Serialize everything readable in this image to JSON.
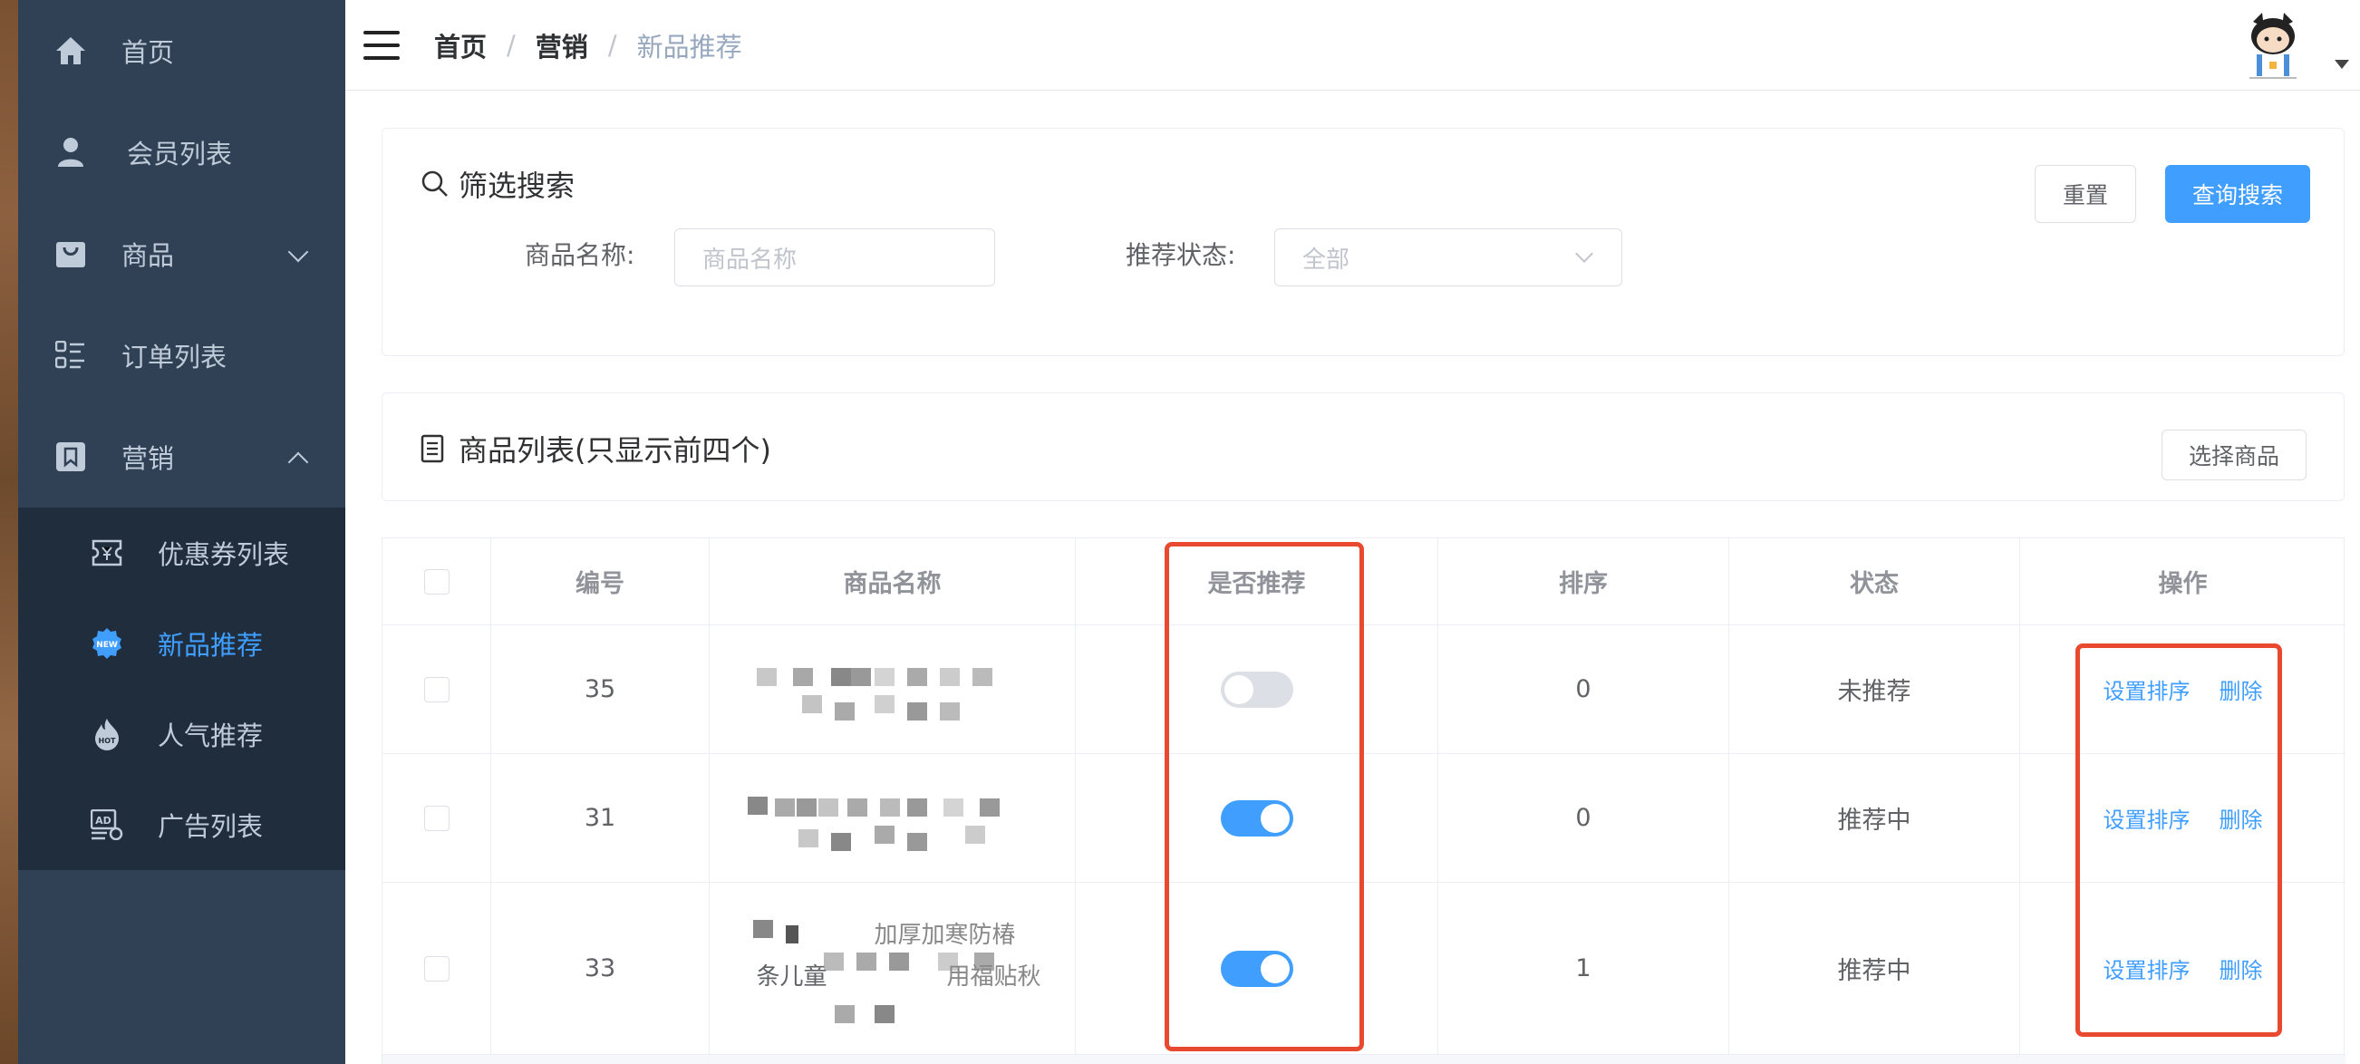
{
  "sidebar": {
    "items": [
      {
        "label": "首页",
        "icon": "home-icon"
      },
      {
        "label": "会员列表",
        "icon": "user-icon"
      },
      {
        "label": "商品",
        "icon": "shopping-bag-icon"
      },
      {
        "label": "订单列表",
        "icon": "list-icon"
      },
      {
        "label": "营销",
        "icon": "bookmark-icon"
      }
    ],
    "submenu": [
      {
        "label": "优惠券列表",
        "icon": "ticket-icon"
      },
      {
        "label": "新品推荐",
        "icon": "new-badge-icon",
        "active": true
      },
      {
        "label": "人气推荐",
        "icon": "hot-fire-icon"
      },
      {
        "label": "广告列表",
        "icon": "ad-icon"
      }
    ]
  },
  "header": {
    "breadcrumb": [
      "首页",
      "营销",
      "新品推荐"
    ],
    "separator": "/"
  },
  "filter": {
    "title": "筛选搜索",
    "name_label": "商品名称:",
    "name_placeholder": "商品名称",
    "status_label": "推荐状态:",
    "status_value": "全部",
    "reset_label": "重置",
    "search_label": "查询搜索"
  },
  "list": {
    "title": "商品列表(只显示前四个)",
    "select_label": "选择商品"
  },
  "table": {
    "columns": [
      "编号",
      "商品名称",
      "是否推荐",
      "排序",
      "状态",
      "操作"
    ],
    "rows": [
      {
        "id": "35",
        "recommended": false,
        "sort": "0",
        "status": "未推荐",
        "name_visible": ""
      },
      {
        "id": "31",
        "recommended": true,
        "sort": "0",
        "status": "推荐中",
        "name_visible": ""
      },
      {
        "id": "33",
        "recommended": true,
        "sort": "1",
        "status": "推荐中",
        "name_visible": "条儿童"
      }
    ],
    "row3_name_fragments": [
      "加厚加寒防椿",
      "用福贴秋"
    ],
    "action_sort": "设置排序",
    "action_delete": "删除"
  },
  "colors": {
    "sidebar_bg": "#304156",
    "submenu_bg": "#1f2d3d",
    "accent": "#409eff",
    "highlight": "#e8492f"
  }
}
